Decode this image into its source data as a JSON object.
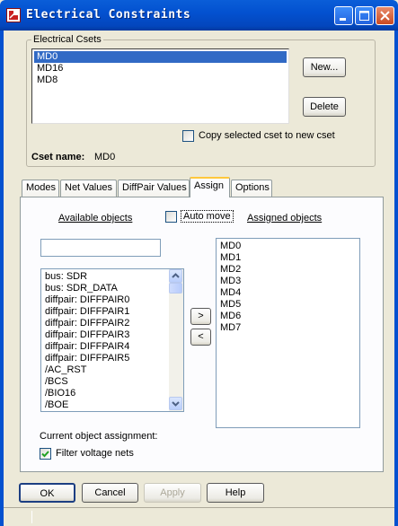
{
  "window": {
    "title": "Electrical Constraints",
    "colors": {
      "titlebar": "#0351d0",
      "selection": "#316ac5",
      "close": "#c94a22",
      "face": "#ece9d8"
    }
  },
  "cset_group": {
    "label": "Electrical Csets",
    "items": [
      {
        "label": "MD0",
        "selected": true
      },
      {
        "label": "MD16",
        "selected": false
      },
      {
        "label": "MD8",
        "selected": false
      }
    ],
    "new_button": "New...",
    "delete_button": "Delete",
    "copy_checkbox": {
      "label": "Copy selected cset to new cset",
      "checked": false
    },
    "cset_name_label": "Cset name:",
    "cset_name_value": "MD0"
  },
  "tabs": [
    {
      "label": "Modes",
      "active": false
    },
    {
      "label": "Net Values",
      "active": false
    },
    {
      "label": "DiffPair Values",
      "active": false
    },
    {
      "label": "Assign",
      "active": true
    },
    {
      "label": "Options",
      "active": false
    }
  ],
  "assign": {
    "available_label": "Available objects",
    "auto_move": {
      "label": "Auto move",
      "checked": false
    },
    "assigned_label": "Assigned objects",
    "filter_value": "",
    "available_objects": [
      "bus: SDR",
      "bus: SDR_DATA",
      "diffpair: DIFFPAIR0",
      "diffpair: DIFFPAIR1",
      "diffpair: DIFFPAIR2",
      "diffpair: DIFFPAIR3",
      "diffpair: DIFFPAIR4",
      "diffpair: DIFFPAIR5",
      "/AC_RST",
      "/BCS",
      "/BIO16",
      "/BOE"
    ],
    "add_button": ">",
    "remove_button": "<",
    "assigned_objects": [
      "MD0",
      "MD1",
      "MD2",
      "MD3",
      "MD4",
      "MD5",
      "MD6",
      "MD7"
    ],
    "current_assignment_label": "Current object assignment:",
    "filter_voltage": {
      "label": "Filter voltage nets",
      "checked": true
    }
  },
  "footer": {
    "ok": "OK",
    "cancel": "Cancel",
    "apply": "Apply",
    "help": "Help"
  },
  "icons": [
    "app-icon",
    "minimize-icon",
    "maximize-icon",
    "close-icon",
    "scroll-up-icon",
    "scroll-down-icon",
    "checkmark-icon"
  ]
}
